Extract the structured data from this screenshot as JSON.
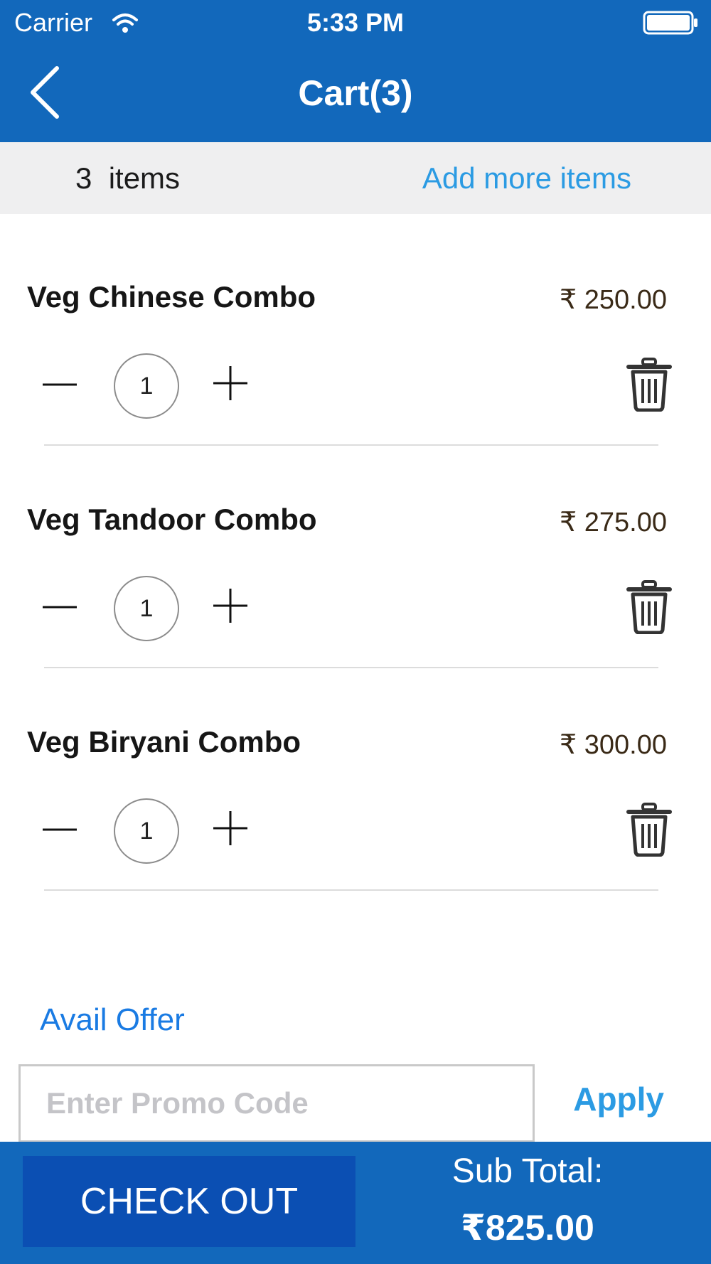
{
  "status_bar": {
    "carrier": "Carrier",
    "time": "5:33 PM",
    "wifi_icon": "wifi-icon",
    "battery_icon": "battery-icon"
  },
  "nav": {
    "back_icon": "chevron-left-icon",
    "title": "Cart(3)"
  },
  "summary": {
    "items_count": "3  items",
    "add_more_label": "Add more items"
  },
  "cart": {
    "items": [
      {
        "name": "Veg Chinese Combo",
        "price": "₹ 250.00",
        "quantity": "1"
      },
      {
        "name": "Veg Tandoor Combo",
        "price": "₹ 275.00",
        "quantity": "1"
      },
      {
        "name": "Veg Biryani Combo",
        "price": "₹ 300.00",
        "quantity": "1"
      }
    ],
    "icons": {
      "decrement": "minus-icon",
      "increment": "plus-icon",
      "delete": "trash-icon"
    }
  },
  "offer": {
    "label": "Avail Offer",
    "promo_placeholder": "Enter Promo Code",
    "promo_value": "",
    "apply_label": "Apply"
  },
  "footer": {
    "checkout_label": "CHECK OUT",
    "subtotal_label": "Sub Total:",
    "subtotal_value": "₹825.00"
  },
  "colors": {
    "header_bg": "#1268bb",
    "checkout_bg": "#0b4fb3",
    "link_blue": "#2b9be3",
    "offer_blue": "#1a7be3",
    "items_bar_bg": "#efeff0"
  }
}
